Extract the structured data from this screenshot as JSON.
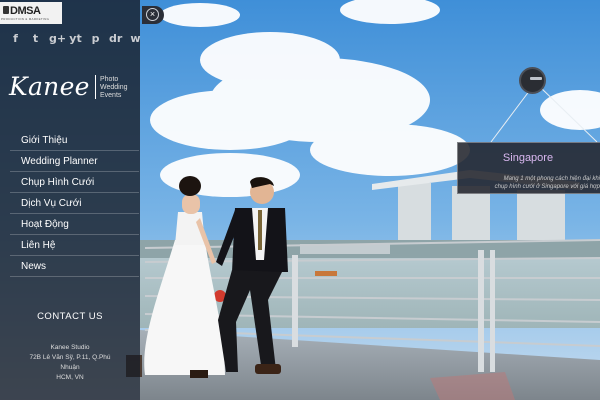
{
  "brand": {
    "logo_main": "DMSA",
    "logo_sub": "PRODUCTION & MARKETING"
  },
  "social": [
    "f",
    "t",
    "g+",
    "yt",
    "p",
    "dr",
    "w"
  ],
  "studio": {
    "name": "Kanee",
    "tagline": [
      "Photo",
      "Wedding",
      "Events"
    ]
  },
  "menu": [
    {
      "label": "Giới Thiệu"
    },
    {
      "label": "Wedding Planner"
    },
    {
      "label": "Chụp Hình Cưới"
    },
    {
      "label": "Dịch Vụ Cưới"
    },
    {
      "label": "Hoạt Động"
    },
    {
      "label": "Liên Hệ"
    },
    {
      "label": "News"
    }
  ],
  "contact": {
    "title": "CONTACT US",
    "lines": [
      "Kanee Studio",
      "72B Lê Văn Sỹ, P.11, Q.Phú",
      "Nhuận",
      "HCM, VN"
    ]
  },
  "close": {
    "label": "×"
  },
  "location": {
    "title": "Singapore",
    "description_lines": [
      "Mang 1 một phong cách hiện đại khi",
      "chụp hình cưới ở Singapore với giá hợp"
    ]
  },
  "colors": {
    "sidebar_bg": "#161a22",
    "accent_purple": "#d9b8f0",
    "sky": "#5a9bd8"
  },
  "icons": {
    "social_names": [
      "facebook-icon",
      "twitter-icon",
      "google-plus-icon",
      "youtube-icon",
      "pinterest-icon",
      "dribbble-icon",
      "wordpress-icon"
    ],
    "close": "close-icon",
    "marker": "location-pin-icon"
  }
}
